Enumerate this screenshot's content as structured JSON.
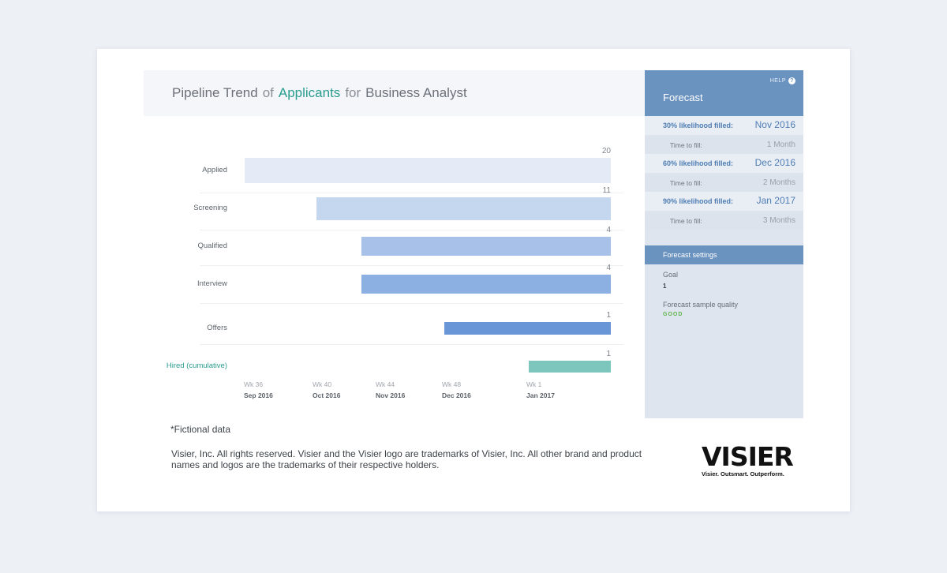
{
  "title": {
    "metric": "Pipeline Trend",
    "of": "of",
    "subject": "Applicants",
    "for": "for",
    "position": "Business Analyst"
  },
  "chart_data": {
    "type": "bar",
    "orientation": "horizontal",
    "categories": [
      "Applied",
      "Screening",
      "Qualified",
      "Interview",
      "Offers",
      "Hired (cumulative)"
    ],
    "values": [
      20,
      11,
      4,
      4,
      1,
      1
    ],
    "x_ticks": [
      {
        "week": "Wk 36",
        "month": "Sep 2016"
      },
      {
        "week": "Wk 40",
        "month": "Oct 2016"
      },
      {
        "week": "Wk 44",
        "month": "Nov 2016"
      },
      {
        "week": "Wk 48",
        "month": "Dec 2016"
      },
      {
        "week": "Wk 1",
        "month": "Jan 2017"
      }
    ],
    "bar_start_week": [
      "Wk 36",
      "Wk 40.6",
      "Wk 43.6",
      "Wk 43.6",
      "Wk 48.3",
      "Wk 1"
    ],
    "bar_end_week": "Wk 3",
    "colors": [
      "#e4ebf6",
      "#c5d7ef",
      "#a7c1e8",
      "#8db0e3",
      "#6896d6",
      "#7dc6be"
    ]
  },
  "forecast": {
    "help": "HELP",
    "title": "Forecast",
    "rows": [
      {
        "likelihood": "30% likelihood filled:",
        "date": "Nov 2016",
        "ttf_label": "Time to fill:",
        "ttf_value": "1 Month"
      },
      {
        "likelihood": "60% likelihood filled:",
        "date": "Dec 2016",
        "ttf_label": "Time to fill:",
        "ttf_value": "2 Months"
      },
      {
        "likelihood": "90% likelihood filled:",
        "date": "Jan 2017",
        "ttf_label": "Time to fill:",
        "ttf_value": "3 Months"
      }
    ],
    "settings": {
      "title": "Forecast settings",
      "goal_label": "Goal",
      "goal_value": "1",
      "quality_label": "Forecast sample quality",
      "quality_value": "GOOD"
    }
  },
  "footnote": "*Fictional data",
  "legal": "Visier, Inc. All rights reserved. Visier and the Visier logo are trademarks of Visier, Inc. All other brand and product names and logos are the trademarks of their respective holders.",
  "logo": {
    "word": "VISIER",
    "tagline": "Visier. Outsmart. Outperform."
  }
}
